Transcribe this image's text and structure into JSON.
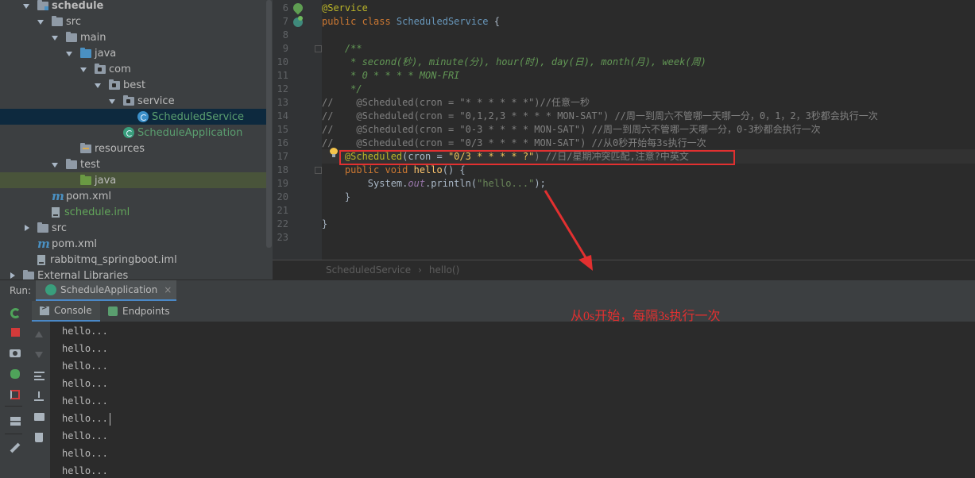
{
  "project_tree": [
    {
      "label": "schedule",
      "indent": 1,
      "expanded": true,
      "icon": "module-folder-icon",
      "bold": true
    },
    {
      "label": "src",
      "indent": 2,
      "expanded": true,
      "icon": "folder-icon"
    },
    {
      "label": "main",
      "indent": 3,
      "expanded": true,
      "icon": "folder-icon"
    },
    {
      "label": "java",
      "indent": 4,
      "expanded": true,
      "icon": "source-folder-icon"
    },
    {
      "label": "com",
      "indent": 5,
      "expanded": true,
      "icon": "package-icon"
    },
    {
      "label": "best",
      "indent": 6,
      "expanded": true,
      "icon": "package-icon"
    },
    {
      "label": "service",
      "indent": 7,
      "expanded": true,
      "icon": "package-icon"
    },
    {
      "label": "ScheduledService",
      "indent": 8,
      "icon": "class-icon",
      "selected": true
    },
    {
      "label": "ScheduleApplication",
      "indent": 7,
      "icon": "spring-class-icon"
    },
    {
      "label": "resources",
      "indent": 4,
      "icon": "resources-folder-icon"
    },
    {
      "label": "test",
      "indent": 3,
      "expanded": true,
      "icon": "folder-icon"
    },
    {
      "label": "java",
      "indent": 4,
      "icon": "test-folder-icon",
      "highlight": true
    },
    {
      "label": "pom.xml",
      "indent": 2,
      "icon": "maven-icon"
    },
    {
      "label": "schedule.iml",
      "indent": 2,
      "icon": "iml-icon"
    },
    {
      "label": "src",
      "indent": 1,
      "collapsed": true,
      "icon": "folder-icon"
    },
    {
      "label": "pom.xml",
      "indent": 1,
      "icon": "maven-icon"
    },
    {
      "label": "rabbitmq_springboot.iml",
      "indent": 1,
      "icon": "iml-icon"
    },
    {
      "label": "External Libraries",
      "indent": 0,
      "collapsed": true,
      "icon": "library-icon"
    }
  ],
  "editor": {
    "line_numbers": [
      "6",
      "7",
      "8",
      "9",
      "10",
      "11",
      "12",
      "13",
      "14",
      "15",
      "16",
      "17",
      "18",
      "19",
      "20",
      "21",
      "22",
      "23"
    ],
    "lines": [
      [
        {
          "t": "@Service",
          "c": "ann"
        }
      ],
      [
        {
          "t": "public class ",
          "c": "kw"
        },
        {
          "t": "ScheduledService",
          "c": "cls"
        },
        {
          "t": " {",
          "c": "plain"
        }
      ],
      [],
      [
        {
          "t": "    /**",
          "c": "doc"
        }
      ],
      [
        {
          "t": "     * second(秒), minute(分), hour(时), day(日), month(月), week(周)",
          "c": "doc"
        }
      ],
      [
        {
          "t": "     * 0 * * * * MON-FRI",
          "c": "doc"
        }
      ],
      [
        {
          "t": "     */",
          "c": "doc"
        }
      ],
      [
        {
          "t": "//    @Scheduled(cron = \"* * * * * *\")//任意一秒",
          "c": "cmt"
        }
      ],
      [
        {
          "t": "//    @Scheduled(cron = \"0,1,2,3 * * * * MON-SAT\") //周一到周六不管哪一天哪一分，0，1，2，3秒都会执行一次",
          "c": "cmt"
        }
      ],
      [
        {
          "t": "//    @Scheduled(cron = \"0-3 * * * * MON-SAT\") //周一到周六不管哪一天哪一分，0-3秒都会执行一次",
          "c": "cmt"
        }
      ],
      [
        {
          "t": "//    @Scheduled(cron = \"0/3 * * * * MON-SAT\") //从0秒开始每3s执行一次",
          "c": "cmt"
        }
      ],
      [
        {
          "t": "    ",
          "c": "plain"
        },
        {
          "t": "@Scheduled",
          "c": "ann"
        },
        {
          "t": "(cron = ",
          "c": "plain"
        },
        {
          "t": "\"0/3 * * * * ?\"",
          "c": "strh"
        },
        {
          "t": ") //日/星期冲突匹配,注意?中英文",
          "c": "cmt"
        }
      ],
      [
        {
          "t": "    public void ",
          "c": "kw"
        },
        {
          "t": "hello",
          "c": "fn"
        },
        {
          "t": "() {",
          "c": "plain"
        }
      ],
      [
        {
          "t": "        System.",
          "c": "plain"
        },
        {
          "t": "out",
          "c": "fld"
        },
        {
          "t": ".println(",
          "c": "plain"
        },
        {
          "t": "\"hello...\"",
          "c": "str"
        },
        {
          "t": ");",
          "c": "plain"
        }
      ],
      [
        {
          "t": "    }",
          "c": "plain"
        }
      ],
      [],
      [
        {
          "t": "}",
          "c": "plain"
        }
      ],
      []
    ]
  },
  "breadcrumb": {
    "class_name": "ScheduledService",
    "separator": "›",
    "method_name": "hello()"
  },
  "run_panel": {
    "run_label": "Run:",
    "tab_label": "ScheduleApplication",
    "tab_close": "×",
    "console_tab": "Console",
    "endpoints_tab": "Endpoints",
    "annotation": "从0s开始，每隔3s执行一次",
    "output_lines": [
      "hello...",
      "hello...",
      "hello...",
      "hello...",
      "hello...",
      "hello...",
      "hello...",
      "hello...",
      "hello..."
    ]
  },
  "colors": {
    "annotation_red": "#e23030",
    "accent_blue": "#4a88c7"
  }
}
